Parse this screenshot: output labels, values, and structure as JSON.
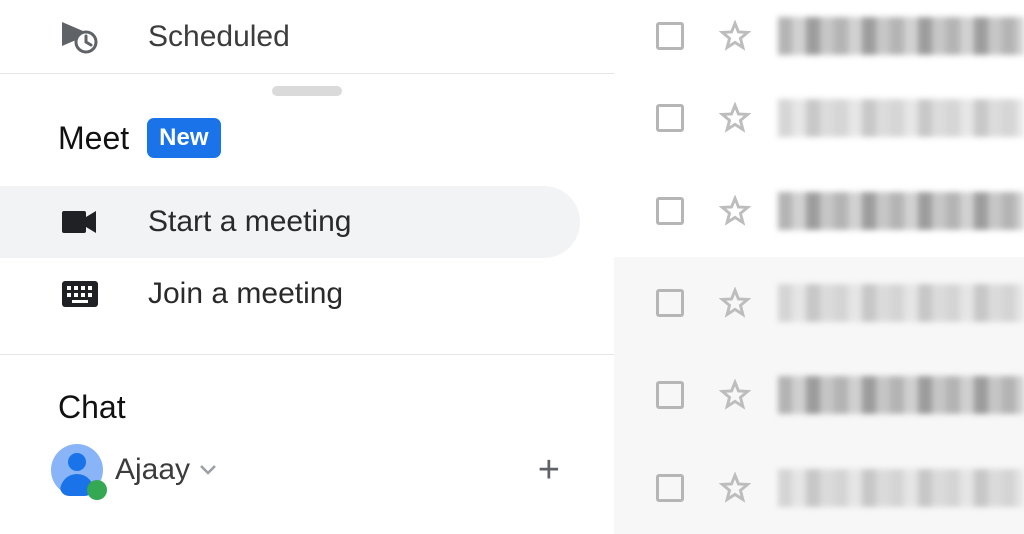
{
  "sidebar": {
    "scheduled_label": "Scheduled",
    "meet": {
      "header_label": "Meet",
      "badge": "New",
      "start_label": "Start a meeting",
      "join_label": "Join a meeting"
    },
    "chat": {
      "header_label": "Chat",
      "user_name": "Ajaay",
      "presence": "online"
    }
  },
  "icons": {
    "scheduled": "scheduled-icon",
    "video": "video-icon",
    "keyboard": "keyboard-icon",
    "caret_down": "caret-down-icon",
    "plus": "+",
    "star": "star-icon",
    "checkbox": "checkbox-icon"
  },
  "mail": {
    "rows": 6
  },
  "colors": {
    "accent": "#1a73e8",
    "badge_bg": "#1a73e8",
    "presence": "#34a853",
    "avatar_bg": "#8ab4f8"
  }
}
